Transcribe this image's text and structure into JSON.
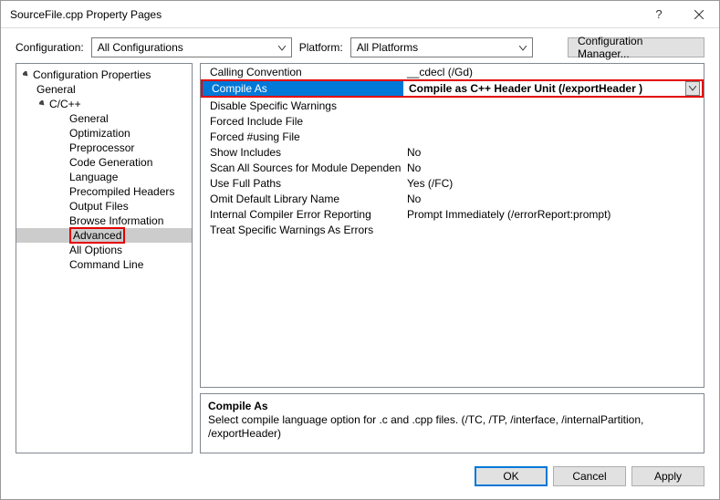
{
  "window": {
    "title": "SourceFile.cpp Property Pages"
  },
  "config_row": {
    "config_label": "Configuration:",
    "config_value": "All Configurations",
    "platform_label": "Platform:",
    "platform_value": "All Platforms",
    "manager_btn": "Configuration Manager..."
  },
  "tree": {
    "root": "Configuration Properties",
    "general": "General",
    "cpp": "C/C++",
    "items": [
      "General",
      "Optimization",
      "Preprocessor",
      "Code Generation",
      "Language",
      "Precompiled Headers",
      "Output Files",
      "Browse Information",
      "Advanced",
      "All Options",
      "Command Line"
    ],
    "selected_index": 8
  },
  "grid": {
    "rows": [
      {
        "k": "Calling Convention",
        "v": "__cdecl (/Gd)"
      },
      {
        "k": "Compile As",
        "v": "Compile as C++ Header Unit (/exportHeader )"
      },
      {
        "k": "Disable Specific Warnings",
        "v": ""
      },
      {
        "k": "Forced Include File",
        "v": ""
      },
      {
        "k": "Forced #using File",
        "v": ""
      },
      {
        "k": "Show Includes",
        "v": "No"
      },
      {
        "k": "Scan All Sources for Module Dependen",
        "v": "No"
      },
      {
        "k": "Use Full Paths",
        "v": "Yes (/FC)"
      },
      {
        "k": "Omit Default Library Name",
        "v": "No"
      },
      {
        "k": "Internal Compiler Error Reporting",
        "v": "Prompt Immediately (/errorReport:prompt)"
      },
      {
        "k": "Treat Specific Warnings As Errors",
        "v": ""
      }
    ]
  },
  "desc": {
    "title": "Compile As",
    "body": "Select compile language option for .c and .cpp files.    (/TC, /TP, /interface, /internalPartition, /exportHeader)"
  },
  "footer": {
    "ok": "OK",
    "cancel": "Cancel",
    "apply": "Apply"
  }
}
